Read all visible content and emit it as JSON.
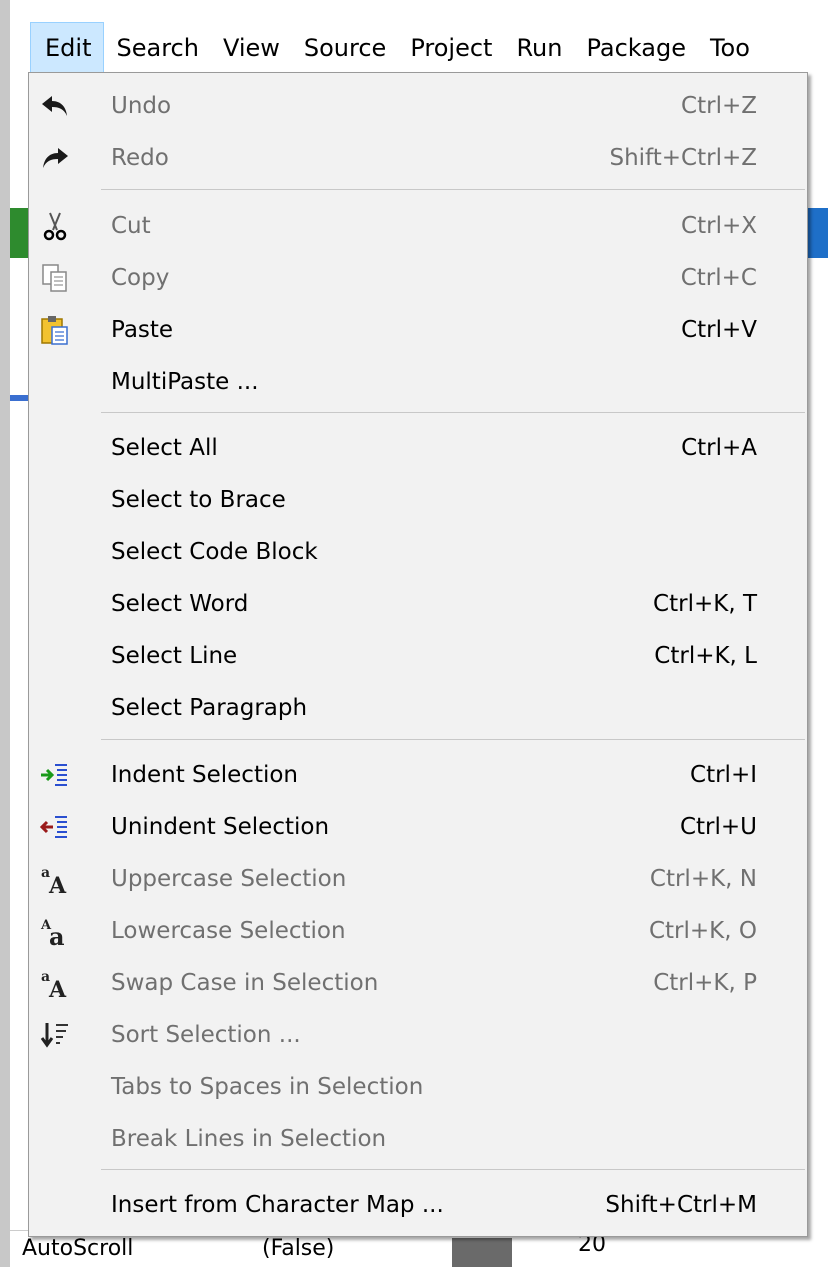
{
  "menubar": {
    "items": [
      "Edit",
      "Search",
      "View",
      "Source",
      "Project",
      "Run",
      "Package",
      "Too"
    ]
  },
  "background": {
    "autoscroll_label": "AutoScroll",
    "autoscroll_value": "(False)",
    "number_fragment": "20"
  },
  "edit_menu": {
    "undo": {
      "label": "Undo",
      "shortcut": "Ctrl+Z"
    },
    "redo": {
      "label": "Redo",
      "shortcut": "Shift+Ctrl+Z"
    },
    "cut": {
      "label": "Cut",
      "shortcut": "Ctrl+X"
    },
    "copy": {
      "label": "Copy",
      "shortcut": "Ctrl+C"
    },
    "paste": {
      "label": "Paste",
      "shortcut": "Ctrl+V"
    },
    "multipaste": {
      "label": "MultiPaste ..."
    },
    "select_all": {
      "label": "Select All",
      "shortcut": "Ctrl+A"
    },
    "select_to_brace": {
      "label": "Select to Brace"
    },
    "select_code_block": {
      "label": "Select Code Block"
    },
    "select_word": {
      "label": "Select Word",
      "shortcut": "Ctrl+K, T"
    },
    "select_line": {
      "label": "Select Line",
      "shortcut": "Ctrl+K, L"
    },
    "select_paragraph": {
      "label": "Select Paragraph"
    },
    "indent": {
      "label": "Indent Selection",
      "shortcut": "Ctrl+I"
    },
    "unindent": {
      "label": "Unindent Selection",
      "shortcut": "Ctrl+U"
    },
    "uppercase": {
      "label": "Uppercase Selection",
      "shortcut": "Ctrl+K, N"
    },
    "lowercase": {
      "label": "Lowercase Selection",
      "shortcut": "Ctrl+K, O"
    },
    "swapcase": {
      "label": "Swap Case in Selection",
      "shortcut": "Ctrl+K, P"
    },
    "sort": {
      "label": "Sort Selection ..."
    },
    "tabs_to_spaces": {
      "label": "Tabs to Spaces in Selection"
    },
    "break_lines": {
      "label": "Break Lines in Selection"
    },
    "insert_char_map": {
      "label": "Insert from Character Map ...",
      "shortcut": "Shift+Ctrl+M"
    }
  },
  "colors": {
    "menu_bg": "#f2f2f2",
    "active_menu_bg": "#cce8ff",
    "disabled_text": "#707070"
  }
}
